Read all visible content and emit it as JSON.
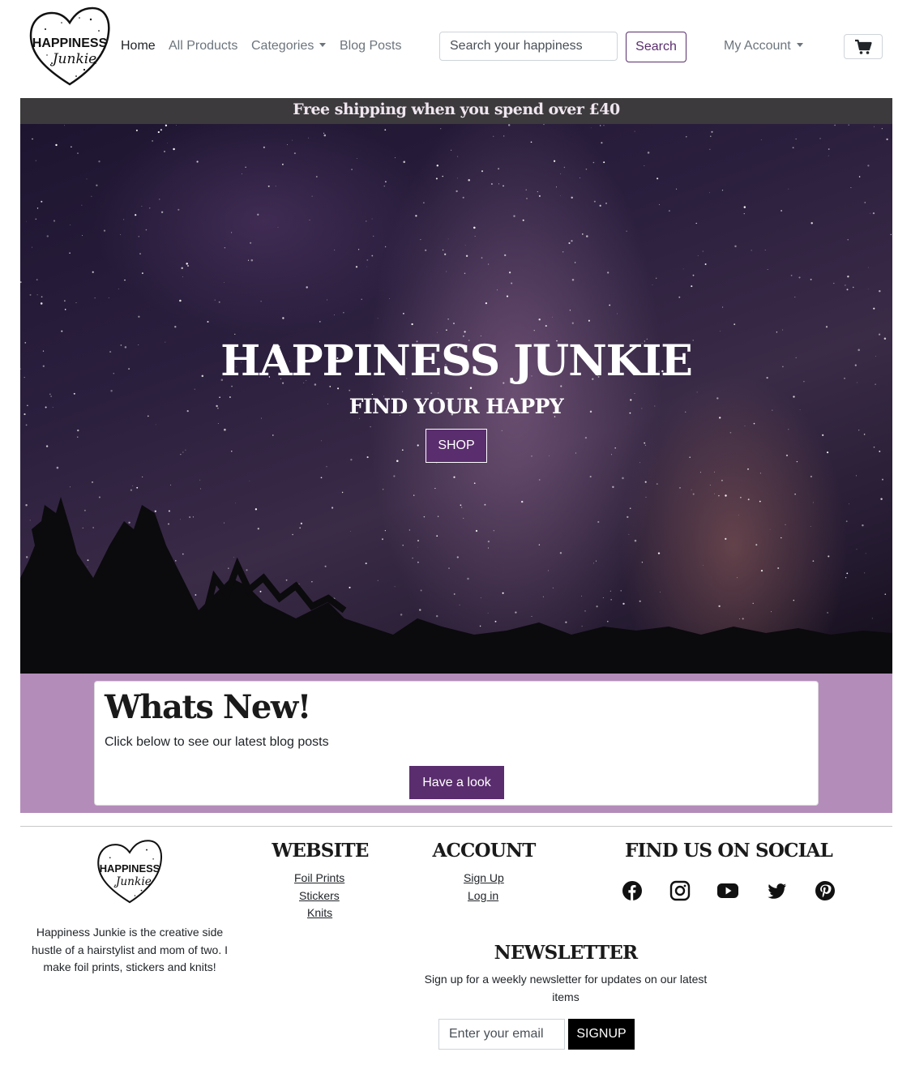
{
  "brand": {
    "logo_line1": "HAPPINESS",
    "logo_line2": "Junkie",
    "accent": "#5a2d6e",
    "band_color": "#b48cba"
  },
  "nav": {
    "home": "Home",
    "all_products": "All Products",
    "categories": "Categories",
    "blog_posts": "Blog Posts",
    "search_placeholder": "Search your happiness",
    "search_button": "Search",
    "my_account": "My Account",
    "cart_icon": "shopping-cart-icon"
  },
  "banner": {
    "text": "Free shipping when you spend over £40"
  },
  "hero": {
    "title": "HAPPINESS JUNKIE",
    "subtitle": "FIND YOUR HAPPY",
    "button": "SHOP"
  },
  "whats_new": {
    "title": "Whats New!",
    "text": "Click below to see our latest blog posts",
    "button": "Have a look"
  },
  "footer": {
    "about": "Happiness Junkie is the creative side hustle of a hairstylist and mom of two. I make foil prints, stickers and knits!",
    "website": {
      "heading": "WEBSITE",
      "links": [
        "Foil Prints",
        "Stickers",
        "Knits"
      ]
    },
    "account": {
      "heading": "ACCOUNT",
      "links": [
        "Sign Up",
        "Log in"
      ]
    },
    "social": {
      "heading": "FIND US ON SOCIAL",
      "icons": [
        "facebook-icon",
        "instagram-icon",
        "youtube-icon",
        "twitter-icon",
        "pinterest-icon"
      ]
    },
    "newsletter": {
      "heading": "NEWSLETTER",
      "text": "Sign up for a weekly newsletter for updates on our latest items",
      "placeholder": "Enter your email",
      "button": "SIGNUP"
    }
  }
}
